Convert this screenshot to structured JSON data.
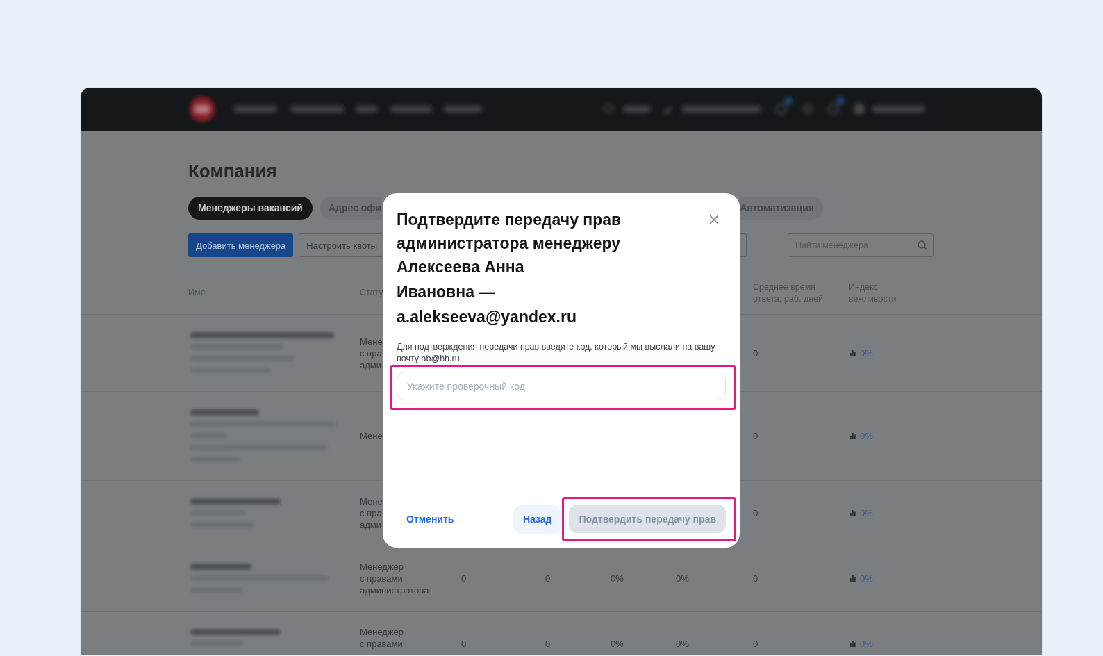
{
  "page_title": "Компания",
  "tabs": [
    {
      "label": "Менеджеры вакансий",
      "selected": true
    },
    {
      "label": "Адрес офи",
      "selected": false
    },
    {
      "label": "Автоматизация",
      "selected": false
    }
  ],
  "actions": [
    {
      "kind": "primary",
      "label": "Добавить менеджера"
    },
    {
      "kind": "outline",
      "label": "Настроить квоты"
    }
  ],
  "search": {
    "placeholder": "Найти менеджера"
  },
  "table": {
    "header": {
      "name": "Имя",
      "status": "Стату",
      "response_time": "Среднее время ответа, раб. дней",
      "politeness": "Индекс вежливости"
    },
    "rows": [
      {
        "status": "Мене\nс пра\nадми",
        "response_time": "0",
        "politeness": "0%"
      },
      {
        "status": "Мене",
        "response_time": "0",
        "politeness": "0%"
      },
      {
        "status": "Мене\nс пра\nадми",
        "response_time": "0",
        "politeness": "0%"
      },
      {
        "status": "Менеджер\nс правами\nадминистратора",
        "column_3": "0",
        "column_4": "0",
        "column_5": "0%",
        "column_6": "0%",
        "response_time": "0",
        "politeness": "0%"
      },
      {
        "status": "Менеджер\nс правами",
        "column_3": "0",
        "column_4": "0",
        "column_5": "0%",
        "column_6": "0%",
        "response_time": "0",
        "politeness": "0%"
      }
    ]
  },
  "dialog": {
    "title": "Подтвердите передачу прав администратора менеджеру",
    "manager": "Алексеева Анна Ивановна —",
    "email": "a.alekseeva@yandex.ru",
    "hint": "Для подтверждения передачи прав введите код, который мы выслали на вашу почту ab@hh.ru",
    "code_field": {
      "placeholder": "Укажите проверочный код",
      "highlighted": true
    },
    "buttons": [
      {
        "kind": "link",
        "label": "Отменить",
        "disabled": false,
        "highlighted": false
      },
      {
        "kind": "secondary",
        "label": "Назад",
        "disabled": false,
        "highlighted": false
      },
      {
        "kind": "primary",
        "label": "Подтвердить передачу прав",
        "disabled": true,
        "highlighted": true
      }
    ]
  }
}
